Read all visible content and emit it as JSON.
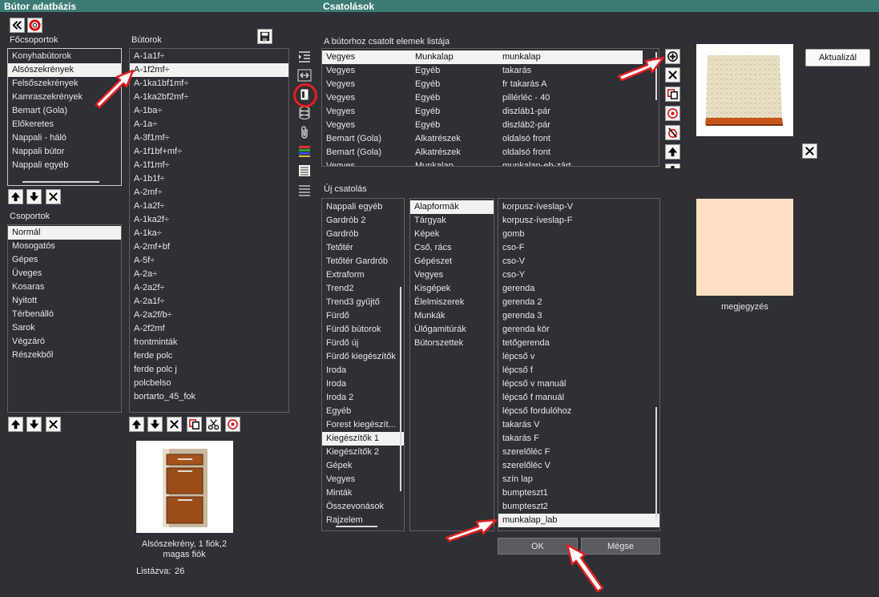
{
  "left_header": {
    "title": "Bútor adatbázis"
  },
  "right_header": {
    "title": "Csatolások"
  },
  "fo_csoportok": {
    "label": "Főcsoportok",
    "items": [
      "Konyhabútorok",
      "Alsószekrények",
      "Felsőszekrények",
      "Kamraszekrények",
      "Bemart (Gola)",
      "Előkeretes",
      "Nappali - háló",
      "Nappali bútor",
      "Nappali egyéb"
    ],
    "selected_index": 1
  },
  "csoportok": {
    "label": "Csoportok",
    "items": [
      "Normál",
      "Mosogatós",
      "Gépes",
      "Üveges",
      "Kosaras",
      "Nyitott",
      "Térbenálló",
      "Sarok",
      "Végzáró",
      "Részekből"
    ],
    "selected_index": 0
  },
  "butorok": {
    "label": "Bútorok",
    "items": [
      "A-1a1f÷",
      "A-1f2mf÷",
      "A-1ka1bf1mf÷",
      "A-1ka2bf2mf÷",
      "A-1ba÷",
      "A-1a÷",
      "A-3f1mf÷",
      "A-1f1bf+mf÷",
      "A-1f1mf÷",
      "A-1b1f÷",
      "A-2mf÷",
      "A-1a2f÷",
      "A-1ka2f÷",
      "A-1ka÷",
      "A-2mf+bf",
      "A-5f÷",
      "A-2a÷",
      "A-2a2f÷",
      "A-2a1f÷",
      "A-2a2f/b÷",
      "A-2f2mf",
      "frontminták",
      "ferde polc",
      "ferde polc j",
      "polcbelso",
      "bortarto_45_fok"
    ],
    "selected_index": 1
  },
  "preview": {
    "caption_line1": "Alsószekrény, 1 fiók,2",
    "caption_line2": "magas fiók",
    "listed_label": "Listázva:",
    "listed_count": "26"
  },
  "attached": {
    "label": "A bútorhoz csatolt elemek listája",
    "rows": [
      [
        "Vegyes",
        "Munkalap",
        "munkalap"
      ],
      [
        "Vegyes",
        "Egyéb",
        "takarás"
      ],
      [
        "Vegyes",
        "Egyéb",
        "fr takarás A"
      ],
      [
        "Vegyes",
        "Egyéb",
        "pillérléc - 40"
      ],
      [
        "Vegyes",
        "Egyéb",
        "diszláb1-pár"
      ],
      [
        "Vegyes",
        "Egyéb",
        "diszláb2-pár"
      ],
      [
        "Bemart (Gola)",
        "Alkatrészek",
        "oldalsó front"
      ],
      [
        "Bemart (Gola)",
        "Alkatrészek",
        "oldalsó front"
      ],
      [
        "Vegyes",
        "Munkalap",
        "munkalap-eb-zárt"
      ]
    ],
    "selected_index": 0
  },
  "new_link": {
    "label": "Új csatolás",
    "col1": [
      "Nappali egyéb",
      "Gardrób 2",
      "Gardrób",
      "Tetőtér",
      "Tetőtér Gardrób",
      "Extraform",
      "Trend2",
      "Trend3 gyűjtő",
      "Fürdő",
      "Fürdő bútorok",
      "Fürdő új",
      "Fürdő kiegészítők",
      "Iroda",
      "Iroda",
      "Iroda 2",
      "Egyéb",
      "Forest kiegészít...",
      "Kiegészítők 1",
      "Kiegészítők 2",
      "Gépek",
      "Vegyes",
      "Minták",
      "Összevonások",
      "Rajzelem"
    ],
    "col1_selected": 17,
    "col2": [
      "Alapformák",
      "Tárgyak",
      "Képek",
      "Cső, rács",
      "Gépészet",
      "Vegyes",
      "Kisgépek",
      "Élelmiszerek",
      "Munkák",
      "Ülőgamitúrák",
      "Bútorszettek"
    ],
    "col2_selected": 0,
    "col3": [
      "korpusz-íveslap-V",
      "korpusz-íveslap-F",
      "gomb",
      "cso-F",
      "cso-V",
      "cso-Y",
      "gerenda",
      "gerenda 2",
      "gerenda 3",
      "gerenda kör",
      "tetőgerenda",
      "lépcső v",
      "lépcső f",
      "lépcső v manuál",
      "lépcső f manuál",
      "lépcső fordulóhoz",
      "takarás V",
      "takarás F",
      "szerelőléc F",
      "szerelőléc V",
      "szín lap",
      "bumpteszt1",
      "bumpteszt2",
      "munkalap_lab"
    ],
    "col3_selected": 23
  },
  "buttons": {
    "ok": "OK",
    "cancel": "Mégse",
    "refresh": "Aktualizál"
  },
  "note": {
    "label": "megjegyzés",
    "color": "#fde0c4"
  },
  "colors": {
    "header": "#3c7b73",
    "background": "#2f3035",
    "arrow": "#e02020"
  }
}
